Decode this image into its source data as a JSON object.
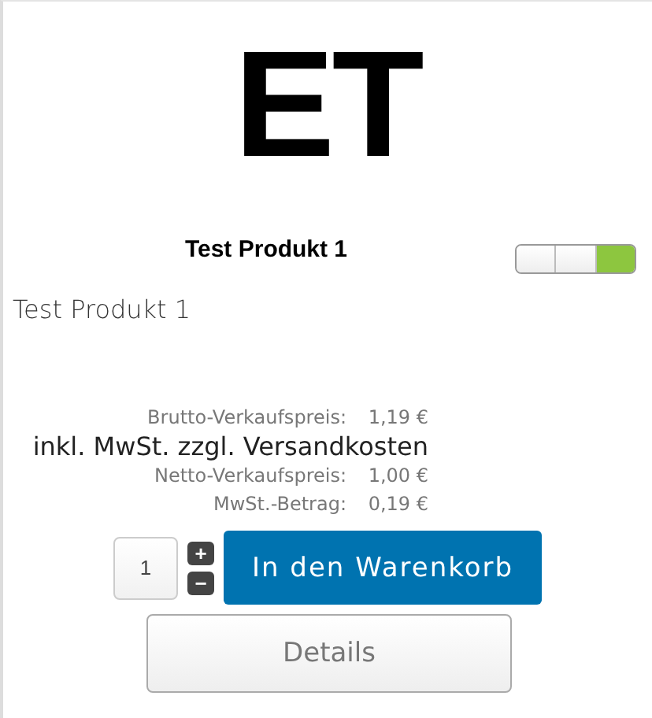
{
  "logo": {
    "text": "ET"
  },
  "product": {
    "title": "Test Produkt 1",
    "description": "Test Produkt 1"
  },
  "stock_indicator": {
    "segments": [
      {
        "on": false
      },
      {
        "on": false
      },
      {
        "on": true
      }
    ]
  },
  "prices": [
    {
      "kind": "row",
      "label": "Brutto-Verkaufspreis:",
      "value": "1,19 €"
    },
    {
      "kind": "note",
      "text": "inkl. MwSt. zzgl. Versandkosten"
    },
    {
      "kind": "row",
      "label": "Netto-Verkaufspreis:",
      "value": "1,00 €"
    },
    {
      "kind": "row",
      "label": "MwSt.-Betrag:",
      "value": "0,19 €"
    }
  ],
  "quantity": {
    "value": "1",
    "plus": "+",
    "minus": "−"
  },
  "buttons": {
    "cart": "In den Warenkorb",
    "details": "Details"
  }
}
